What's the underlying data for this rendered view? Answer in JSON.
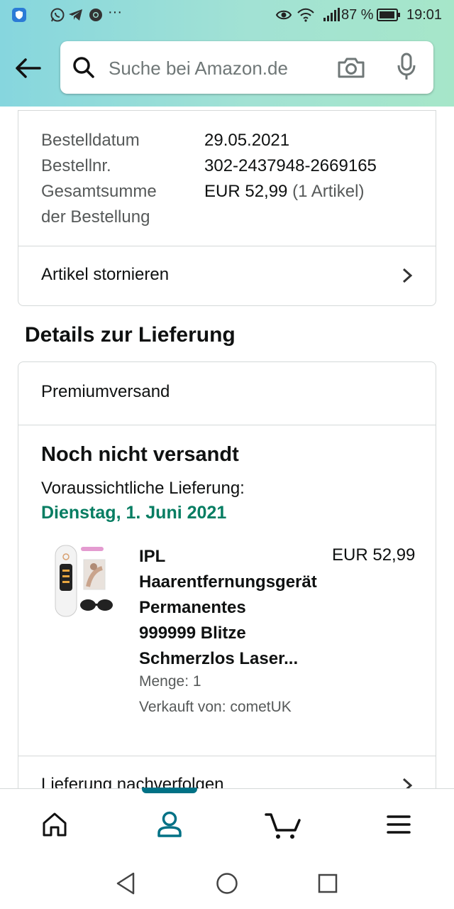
{
  "status_bar": {
    "battery": "87 %",
    "time": "19:01",
    "more_indicator": "···"
  },
  "search": {
    "placeholder": "Suche bei Amazon.de"
  },
  "order_summary": {
    "date_label": "Bestelldatum",
    "date_value": "29.05.2021",
    "number_label": "Bestellnr.",
    "number_value": "302-2437948-2669165",
    "total_label_line1": "Gesamtsumme",
    "total_label_line2": "der Bestellung",
    "total_value": "EUR 52,99",
    "total_items": "(1 Artikel)",
    "cancel_label": "Artikel stornieren"
  },
  "delivery": {
    "heading": "Details zur Lieferung",
    "shipping_method": "Premiumversand",
    "status": "Noch nicht versandt",
    "expected_label": "Voraussichtliche Lieferung:",
    "expected_date": "Dienstag, 1. Juni 2021",
    "item": {
      "title_lines": [
        "IPL",
        "Haarentfernungsgerät",
        "Permanentes",
        "999999 Blitze",
        "Schmerzlos Laser..."
      ],
      "price": "EUR 52,99",
      "quantity": "Menge: 1",
      "seller": "Verkauft von: cometUK"
    },
    "track_label": "Lieferung nachverfolgen"
  },
  "colors": {
    "accent_teal": "#007185",
    "delivery_green": "#067d62",
    "border": "#d5d9d9"
  },
  "bottom_nav": [
    "home-icon",
    "account-icon",
    "cart-icon",
    "menu-icon"
  ],
  "system_nav": [
    "back-triangle-icon",
    "home-circle-icon",
    "recents-square-icon"
  ]
}
